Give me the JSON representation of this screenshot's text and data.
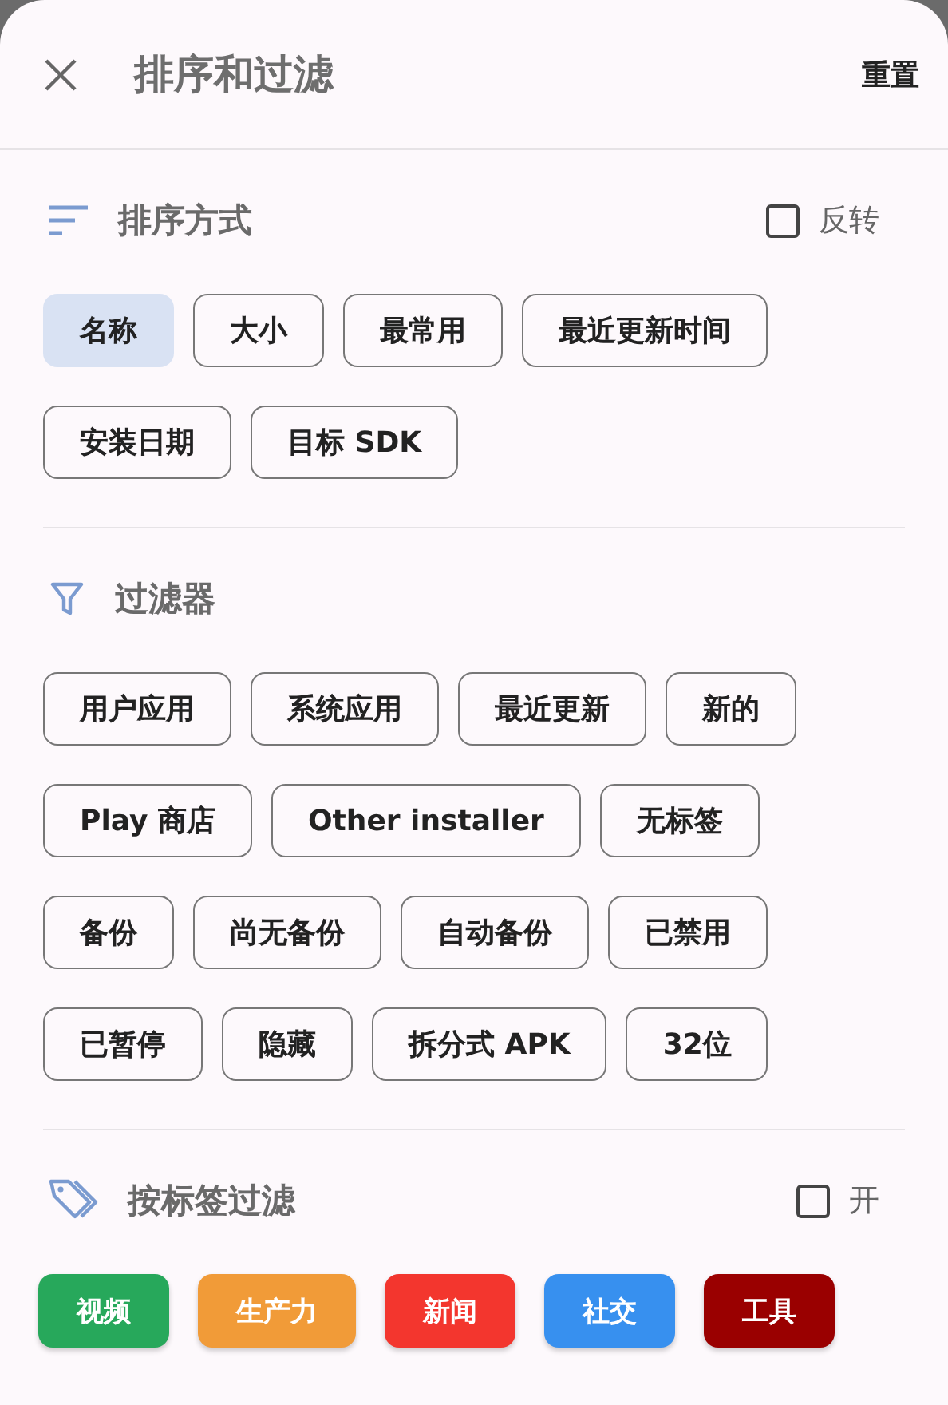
{
  "header": {
    "title": "排序和过滤",
    "reset": "重置"
  },
  "sort": {
    "title": "排序方式",
    "reverse": {
      "label": "反转",
      "checked": false
    },
    "options": [
      {
        "label": "名称",
        "selected": true
      },
      {
        "label": "大小",
        "selected": false
      },
      {
        "label": "最常用",
        "selected": false
      },
      {
        "label": "最近更新时间",
        "selected": false
      },
      {
        "label": "安装日期",
        "selected": false
      },
      {
        "label": "目标 SDK",
        "selected": false
      }
    ]
  },
  "filters": {
    "title": "过滤器",
    "options": [
      {
        "label": "用户应用",
        "selected": false
      },
      {
        "label": "系统应用",
        "selected": false
      },
      {
        "label": "最近更新",
        "selected": false
      },
      {
        "label": "新的",
        "selected": false
      },
      {
        "label": "Play 商店",
        "selected": false
      },
      {
        "label": "Other installer",
        "selected": false
      },
      {
        "label": "无标签",
        "selected": false
      },
      {
        "label": "备份",
        "selected": false
      },
      {
        "label": "尚无备份",
        "selected": false
      },
      {
        "label": "自动备份",
        "selected": false
      },
      {
        "label": "已禁用",
        "selected": false
      },
      {
        "label": "已暂停",
        "selected": false
      },
      {
        "label": "隐藏",
        "selected": false
      },
      {
        "label": "拆分式 APK",
        "selected": false
      },
      {
        "label": "32位",
        "selected": false
      }
    ]
  },
  "tag_filter": {
    "title": "按标签过滤",
    "toggle": {
      "label": "开",
      "checked": false
    },
    "tags": [
      {
        "label": "视频",
        "color": "#27a85b"
      },
      {
        "label": "生产力",
        "color": "#f19b38"
      },
      {
        "label": "新闻",
        "color": "#f3362e"
      },
      {
        "label": "社交",
        "color": "#3790ef"
      },
      {
        "label": "工具",
        "color": "#9a0000"
      }
    ]
  }
}
